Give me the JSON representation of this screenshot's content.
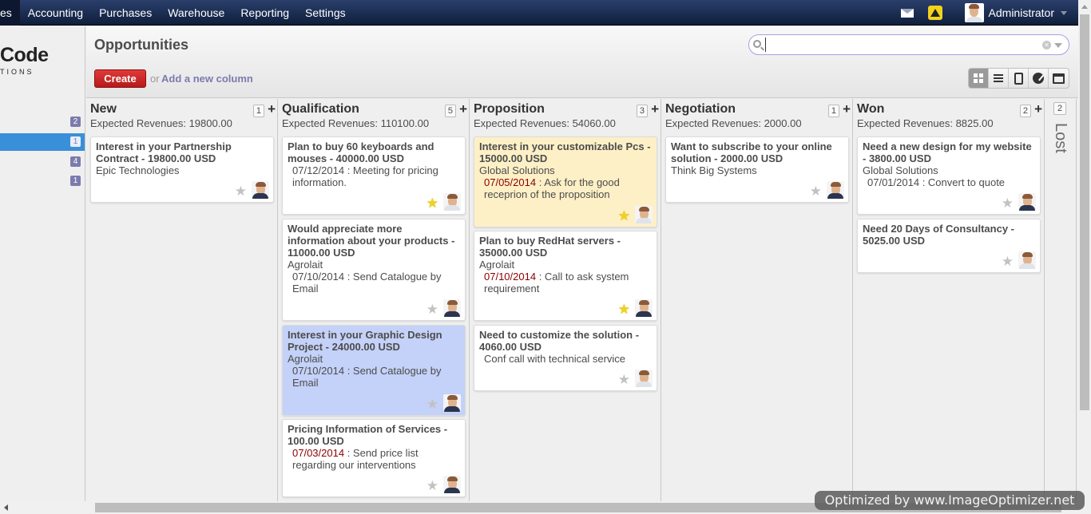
{
  "topbar": {
    "menu": [
      "es",
      "Accounting",
      "Purchases",
      "Warehouse",
      "Reporting",
      "Settings"
    ],
    "user": "Administrator"
  },
  "sidebar": {
    "logo_main": "Code",
    "logo_sub": "TIONS",
    "badges": [
      "2",
      "1",
      "4",
      "1"
    ]
  },
  "header": {
    "title": "Opportunities",
    "create_label": "Create",
    "or_text": "or",
    "add_column_label": "Add a new column",
    "search_value": "",
    "search_placeholder": ""
  },
  "views": [
    "kanban",
    "list",
    "form",
    "graph",
    "calendar"
  ],
  "columns": [
    {
      "title": "New",
      "count": "1",
      "revenue": "Expected Revenues: 19800.00",
      "cards": [
        {
          "title": "Interest in your Partnership Contract - 19800.00 USD",
          "partner": "Epic Technologies",
          "date": "",
          "activity": "",
          "starred": false,
          "color": "white"
        }
      ]
    },
    {
      "title": "Qualification",
      "count": "5",
      "revenue": "Expected Revenues: 110100.00",
      "cards": [
        {
          "title": "Plan to buy 60 keyboards and mouses - 40000.00 USD",
          "partner": "",
          "date": "07/12/2014",
          "activity": " : Meeting for pricing information.",
          "overdue": false,
          "starred": true,
          "color": "white"
        },
        {
          "title": "Would appreciate more information about your products - 11000.00 USD",
          "partner": "Agrolait",
          "date": "07/10/2014",
          "activity": " : Send Catalogue by Email",
          "overdue": false,
          "starred": false,
          "color": "white"
        },
        {
          "title": "Interest in your Graphic Design Project - 24000.00 USD",
          "partner": "Agrolait",
          "date": "07/10/2014",
          "activity": " : Send Catalogue by Email",
          "overdue": false,
          "starred": false,
          "color": "blue"
        },
        {
          "title": "Pricing Information of Services - 100.00 USD",
          "partner": "",
          "date": "07/03/2014",
          "activity": " : Send price list regarding our interventions",
          "overdue": true,
          "starred": false,
          "color": "white"
        }
      ]
    },
    {
      "title": "Proposition",
      "count": "3",
      "revenue": "Expected Revenues: 54060.00",
      "cards": [
        {
          "title": "Interest in your customizable Pcs - 15000.00 USD",
          "partner": "Global Solutions",
          "date": "07/05/2014",
          "activity": " : Ask for the good receprion of the proposition",
          "overdue": true,
          "starred": true,
          "color": "yellow"
        },
        {
          "title": "Plan to buy RedHat servers - 35000.00 USD",
          "partner": "Agrolait",
          "date": "07/10/2014",
          "activity": " : Call to ask system requirement",
          "overdue": true,
          "starred": true,
          "color": "white"
        },
        {
          "title": "Need to customize the solution - 4060.00 USD",
          "partner": "",
          "date": "",
          "activity": "Conf call with technical service",
          "overdue": false,
          "starred": false,
          "color": "white"
        }
      ]
    },
    {
      "title": "Negotiation",
      "count": "1",
      "revenue": "Expected Revenues: 2000.00",
      "cards": [
        {
          "title": "Want to subscribe to your online solution - 2000.00 USD",
          "partner": "Think Big Systems",
          "date": "",
          "activity": "",
          "starred": false,
          "color": "white"
        }
      ]
    },
    {
      "title": "Won",
      "count": "2",
      "revenue": "Expected Revenues: 8825.00",
      "cards": [
        {
          "title": "Need a new design for my website - 3800.00 USD",
          "partner": "Global Solutions",
          "date": "07/01/2014",
          "activity": " : Convert to quote",
          "overdue": false,
          "starred": false,
          "color": "white"
        },
        {
          "title": "Need 20 Days of Consultancy - 5025.00 USD",
          "partner": "",
          "date": "",
          "activity": "",
          "starred": false,
          "color": "white"
        }
      ]
    }
  ],
  "lost": {
    "title": "Lost",
    "count": "2"
  },
  "watermark": "Optimized by www.ImageOptimizer.net",
  "colors": {
    "accent": "#7c7bad",
    "create": "#c91f1f",
    "overdue": "#8b0000",
    "nav": "#1a2b50"
  }
}
